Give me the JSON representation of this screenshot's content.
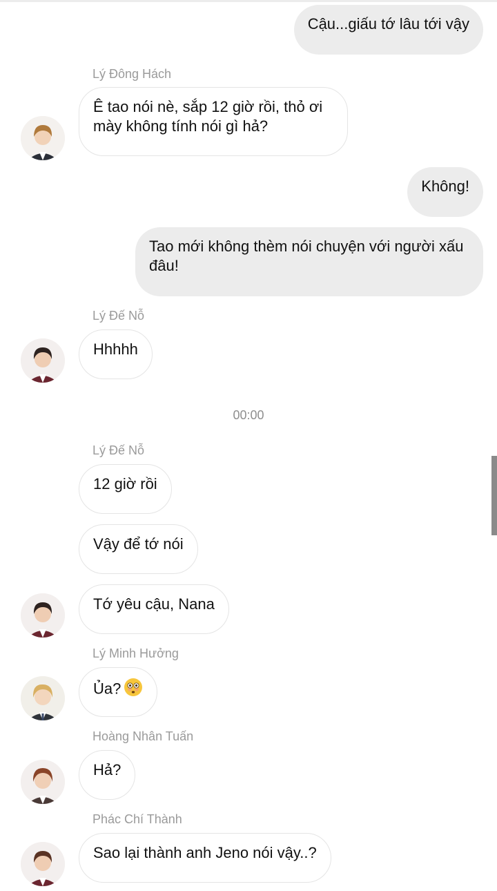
{
  "chat": {
    "time_separator": "00:00",
    "messages": [
      {
        "side": "out",
        "text": "Cậu...giấu tớ lâu tới vậy"
      },
      {
        "side": "in",
        "sender": "Lý Đông Hách",
        "text": "Ê tao nói nè, sắp 12 giờ rồi, thỏ ơi mày không tính nói gì hả?"
      },
      {
        "side": "out",
        "text": "Không!"
      },
      {
        "side": "out",
        "text": "Tao mới không thèm nói chuyện với người xấu đâu!"
      },
      {
        "side": "in",
        "sender": "Lý Đế Nỗ",
        "text": "Hhhhh"
      },
      {
        "side": "in",
        "sender": "Lý Đế Nỗ",
        "text": "12 giờ rồi"
      },
      {
        "side": "in",
        "text": "Vậy để tớ nói"
      },
      {
        "side": "in",
        "text": "Tớ yêu cậu, Nana"
      },
      {
        "side": "in",
        "sender": "Lý Minh Hưởng",
        "text": "Ủa?",
        "emoji": "flushed-face"
      },
      {
        "side": "in",
        "sender": "Hoàng Nhân Tuấn",
        "text": "Hả?"
      },
      {
        "side": "in",
        "sender": "Phác Chí Thành",
        "text": "Sao lại thành anh Jeno nói vậy..?"
      }
    ]
  },
  "colors": {
    "outgoing_bubble": "#ececec",
    "incoming_bubble_border": "#e4e4e4",
    "sender_name": "#9a9a9a",
    "scrollbar": "#8a8a8a"
  }
}
